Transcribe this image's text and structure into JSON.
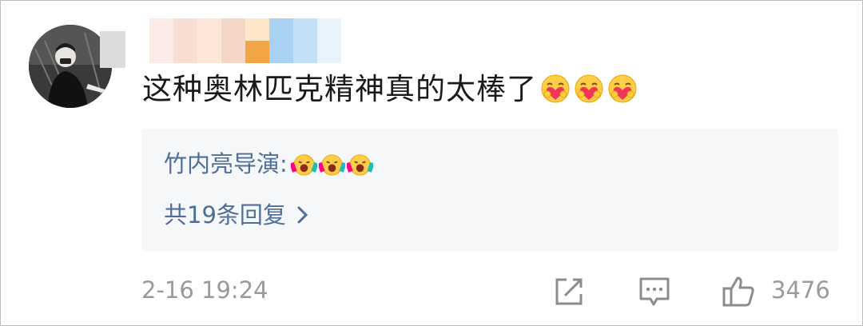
{
  "comment": {
    "text": "这种奥林匹克精神真的太棒了",
    "emojis": [
      "heart-hug-emoji",
      "heart-hug-emoji",
      "heart-hug-emoji"
    ]
  },
  "reply_preview": {
    "author": "竹内亮导演",
    "separator": ":",
    "emojis": [
      "cheering-emoji",
      "cheering-emoji",
      "cheering-emoji"
    ],
    "count_text": "共19条回复"
  },
  "footer": {
    "timestamp": "2-16 19:24",
    "like_count": "3476"
  },
  "colors": {
    "link_blue": "#4f6f99",
    "reply_bg": "#f6f7f9",
    "meta_gray": "#9a9a9a",
    "text": "#1a1a1a"
  }
}
